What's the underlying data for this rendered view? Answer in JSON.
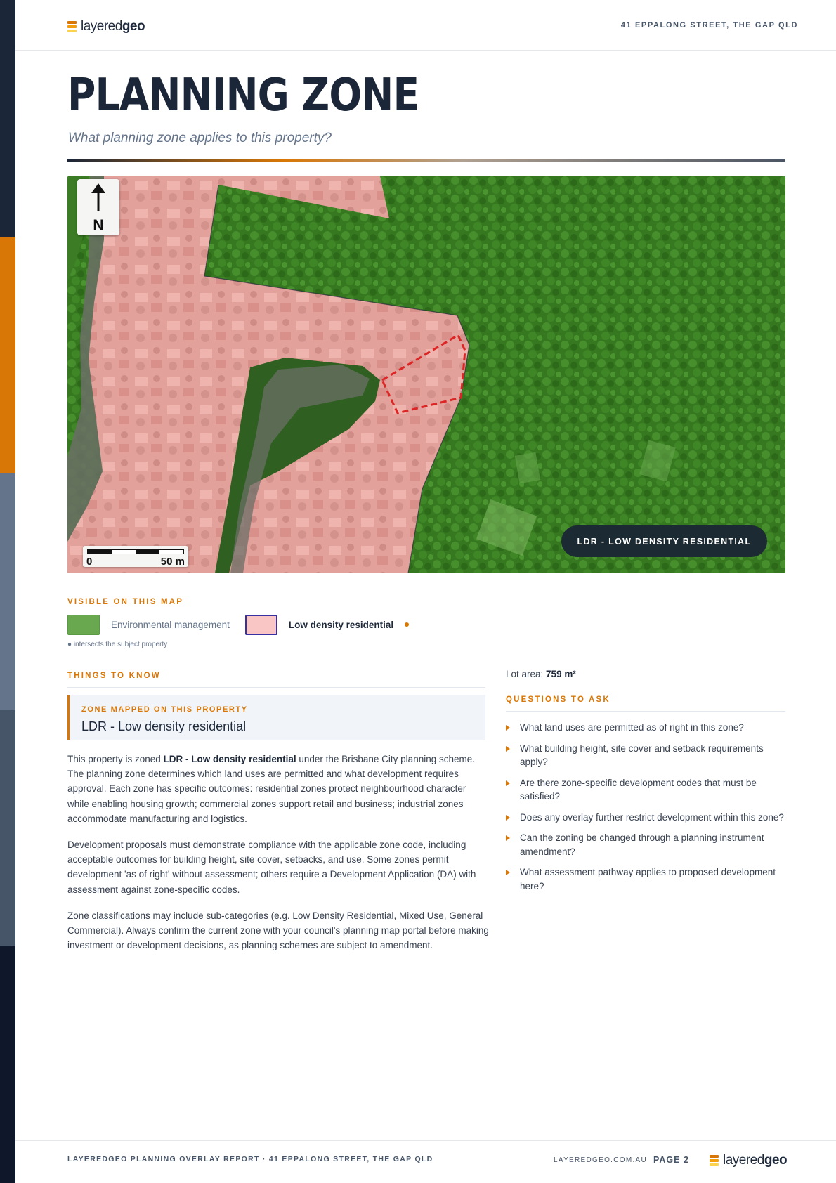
{
  "theme": {
    "navy": "#1b2638",
    "accent": "#d97706",
    "side_bar_colors": [
      "#1b2638",
      "#d97706",
      "#64748b",
      "#475569",
      "#0f172a"
    ]
  },
  "header": {
    "logo_light": "layered",
    "logo_bold": "geo",
    "address": "41 EPPALONG STREET, THE GAP QLD"
  },
  "page": {
    "title": "PLANNING ZONE",
    "subtitle": "What planning zone applies to this property?"
  },
  "map": {
    "north_label": "N",
    "scale_start": "0",
    "scale_end": "50 m",
    "zone_pill": "LDR - LOW DENSITY RESIDENTIAL",
    "colors": {
      "environmental_fill": "#3f8a27",
      "residential_fill": "#e8a3a0",
      "boundary": "#dc2626"
    }
  },
  "legend": {
    "heading": "VISIBLE ON THIS MAP",
    "items": [
      {
        "label": "Environmental management",
        "color": "#6aa84f",
        "border": "#5b9a44",
        "intersects": false
      },
      {
        "label": "Low density residential",
        "color": "#f9c5c5",
        "border": "#3730a3",
        "intersects": true
      }
    ],
    "note": "● intersects the subject property"
  },
  "things": {
    "heading": "THINGS TO KNOW",
    "card_label": "ZONE MAPPED ON THIS PROPERTY",
    "card_value": "LDR - Low density residential",
    "p1_before": "This property is zoned ",
    "p1_bold": "LDR - Low density residential",
    "p1_after": " under the Brisbane City planning scheme. The planning zone determines which land uses are permitted and what development requires approval. Each zone has specific outcomes: residential zones protect neighbourhood character while enabling housing growth; commercial zones support retail and business; industrial zones accommodate manufacturing and logistics.",
    "p2": "Development proposals must demonstrate compliance with the applicable zone code, including acceptable outcomes for building height, site cover, setbacks, and use. Some zones permit development 'as of right' without assessment; others require a Development Application (DA) with assessment against zone-specific codes.",
    "p3": "Zone classifications may include sub-categories (e.g. Low Density Residential, Mixed Use, General Commercial). Always confirm the current zone with your council's planning map portal before making investment or development decisions, as planning schemes are subject to amendment."
  },
  "lot": {
    "label": "Lot area: ",
    "value": "759 m²"
  },
  "questions": {
    "heading": "QUESTIONS TO ASK",
    "items": [
      "What land uses are permitted as of right in this zone?",
      "What building height, site cover and setback requirements apply?",
      "Are there zone-specific development codes that must be satisfied?",
      "Does any overlay further restrict development within this zone?",
      "Can the zoning be changed through a planning instrument amendment?",
      "What assessment pathway applies to proposed development here?"
    ]
  },
  "footer": {
    "report": "LAYEREDGEO PLANNING OVERLAY REPORT · 41 EPPALONG STREET, THE GAP QLD",
    "site": "LAYEREDGEO.COM.AU",
    "page": "PAGE 2"
  }
}
